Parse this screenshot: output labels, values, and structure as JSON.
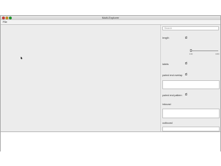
{
  "window": {
    "title": "Multi-Explorer"
  },
  "menu": {
    "file": "File"
  },
  "search": {
    "placeholder": "Search"
  },
  "panel": {
    "length_label": "length",
    "length_slider_min": "0.00",
    "length_slider_max": "1000",
    "length_slider_value": 0,
    "labels_label": "labels",
    "paired_end_overlap_label": "paired end overlap",
    "paired_end_pattern_label": "paired end pattern",
    "inbound_label": "inbound",
    "outbound_label": "outbound"
  }
}
